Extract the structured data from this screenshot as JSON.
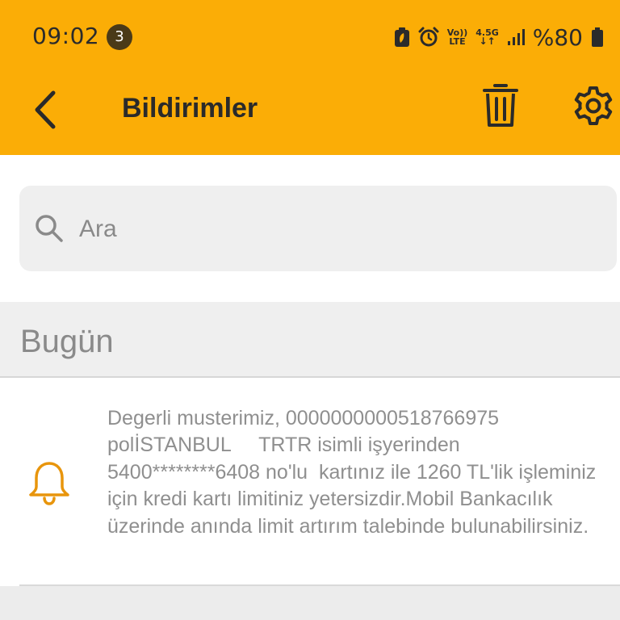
{
  "status_bar": {
    "time": "09:02",
    "notification_count": "3",
    "net_volte_top": "Vo))",
    "net_volte_bottom": "LTE",
    "net_type": "4.5G",
    "battery_text": "%80"
  },
  "app_bar": {
    "title": "Bildirimler",
    "back_icon": "chevron-left-icon",
    "trash_icon": "trash-icon",
    "settings_icon": "gear-icon"
  },
  "search": {
    "placeholder": "Ara",
    "value": ""
  },
  "sections": [
    {
      "title": "Bugün",
      "items": [
        {
          "icon": "bell-icon",
          "text": "Degerli musterimiz, 0000000000518766975 polİSTANBUL     TRTR isimli işyerinden 5400********6408 no'lu  kartınız ile 1260 TL'lik işleminiz için kredi kartı limitiniz yetersizdir.Mobil Bankacılık üzerinde anında limit artırım talebinde bulunabilirsiniz."
        }
      ]
    }
  ],
  "colors": {
    "brand_yellow": "#fbad06",
    "bell_orange": "#e8950c",
    "text_dark": "#2a2a2a",
    "text_muted": "#8f8f8f"
  }
}
